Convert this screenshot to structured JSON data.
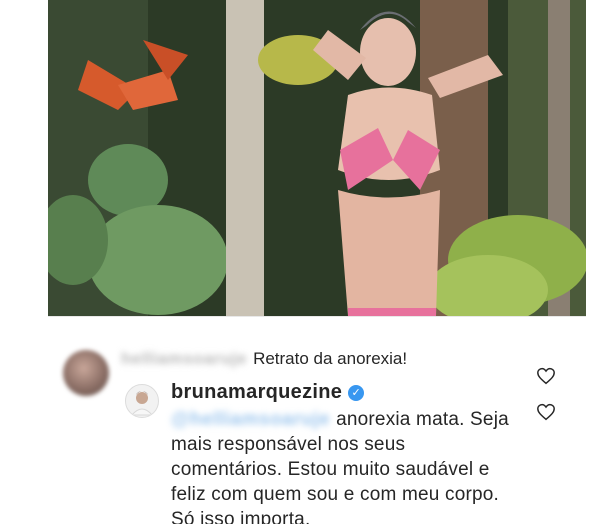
{
  "post": {
    "image_alt": "photo"
  },
  "comments": [
    {
      "username": "helliamsoaruje",
      "text": "Retrato da anorexia!",
      "like_icon": "heart-outline-icon"
    },
    {
      "username": "brunamarquezine",
      "verified": true,
      "verified_icon": "verified-check-icon",
      "mention": "@helliamsoaruje",
      "text": "anorexia mata. Seja mais responsável nos seus comentários. Estou muito saudável e feliz com quem sou e com meu corpo. Só isso importa.",
      "like_icon": "heart-outline-icon"
    }
  ],
  "colors": {
    "accent_verified": "#3897f0",
    "text": "#262626",
    "background": "#ffffff"
  }
}
